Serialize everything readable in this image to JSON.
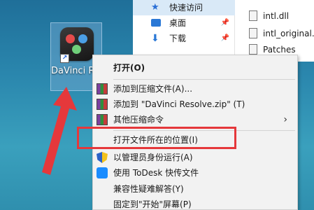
{
  "desktop": {
    "icon_label": "DaVinci Resolve"
  },
  "explorer": {
    "nav": [
      {
        "label": "快速访问",
        "icon": "star-icon",
        "pinned": false
      },
      {
        "label": "桌面",
        "icon": "desktop-icon",
        "pinned": true
      },
      {
        "label": "下载",
        "icon": "download-icon",
        "pinned": true
      }
    ],
    "files": [
      {
        "label": "intl.dll",
        "icon": "file-icon"
      },
      {
        "label": "intl_original.d",
        "icon": "file-icon"
      },
      {
        "label": "Patches",
        "icon": "file-icon"
      }
    ]
  },
  "context_menu": {
    "items": [
      {
        "label": "打开(O)",
        "icon": "",
        "bold": true
      },
      {
        "label": "添加到压缩文件(A)...",
        "icon": "rar-icon"
      },
      {
        "label": "添加到 \"DaVinci Resolve.zip\" (T)",
        "icon": "rar-icon"
      },
      {
        "label": "其他压缩命令",
        "icon": "rar-icon",
        "submenu": true
      },
      {
        "label": "打开文件所在的位置(I)",
        "icon": ""
      },
      {
        "label": "以管理员身份运行(A)",
        "icon": "shield-icon"
      },
      {
        "label": "使用 ToDesk 快传文件",
        "icon": "todesk-icon"
      },
      {
        "label": "兼容性疑难解答(Y)",
        "icon": ""
      },
      {
        "label": "固定到\"开始\"屏幕(P)",
        "icon": ""
      }
    ]
  },
  "annotation": {
    "highlight_color": "#e5383b"
  }
}
